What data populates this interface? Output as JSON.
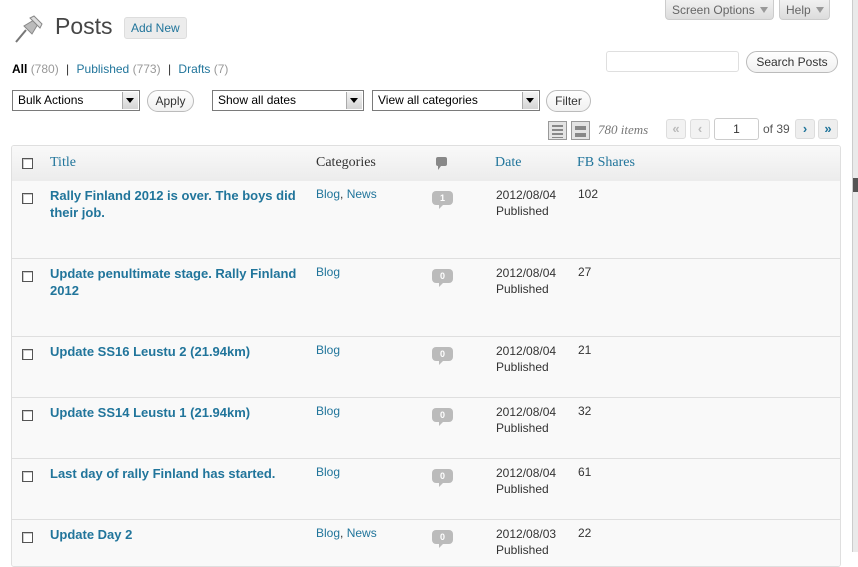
{
  "screen_options": "Screen Options",
  "help": "Help",
  "header": {
    "title": "Posts",
    "add_new": "Add New"
  },
  "filters": {
    "all_label": "All",
    "all_count": "(780)",
    "published_label": "Published",
    "published_count": "(773)",
    "drafts_label": "Drafts",
    "drafts_count": "(7)"
  },
  "search": {
    "value": "",
    "button": "Search Posts"
  },
  "actions": {
    "bulk": "Bulk Actions",
    "apply": "Apply",
    "dates": "Show all dates",
    "categories": "View all categories",
    "filter": "Filter"
  },
  "pagination": {
    "items": "780 items",
    "first": "«",
    "prev": "‹",
    "current": "1",
    "of": "of 39",
    "next": "›",
    "last": "»"
  },
  "columns": {
    "title": "Title",
    "categories": "Categories",
    "date": "Date",
    "shares": "FB Shares"
  },
  "posts": [
    {
      "title": "Rally Finland 2012 is over. The boys did their job.",
      "categories": [
        "Blog",
        "News"
      ],
      "comments": "1",
      "date": "2012/08/04",
      "status": "Published",
      "shares": "102"
    },
    {
      "title": "Update penultimate stage. Rally Finland 2012",
      "categories": [
        "Blog"
      ],
      "comments": "0",
      "date": "2012/08/04",
      "status": "Published",
      "shares": "27"
    },
    {
      "title": "Update SS16 Leustu 2 (21.94km)",
      "categories": [
        "Blog"
      ],
      "comments": "0",
      "date": "2012/08/04",
      "status": "Published",
      "shares": "21"
    },
    {
      "title": "Update SS14 Leustu 1 (21.94km)",
      "categories": [
        "Blog"
      ],
      "comments": "0",
      "date": "2012/08/04",
      "status": "Published",
      "shares": "32"
    },
    {
      "title": "Last day of rally Finland has started.",
      "categories": [
        "Blog"
      ],
      "comments": "0",
      "date": "2012/08/04",
      "status": "Published",
      "shares": "61"
    },
    {
      "title": "Update Day 2",
      "categories": [
        "Blog",
        "News"
      ],
      "comments": "0",
      "date": "2012/08/03",
      "status": "Published",
      "shares": "22"
    }
  ]
}
